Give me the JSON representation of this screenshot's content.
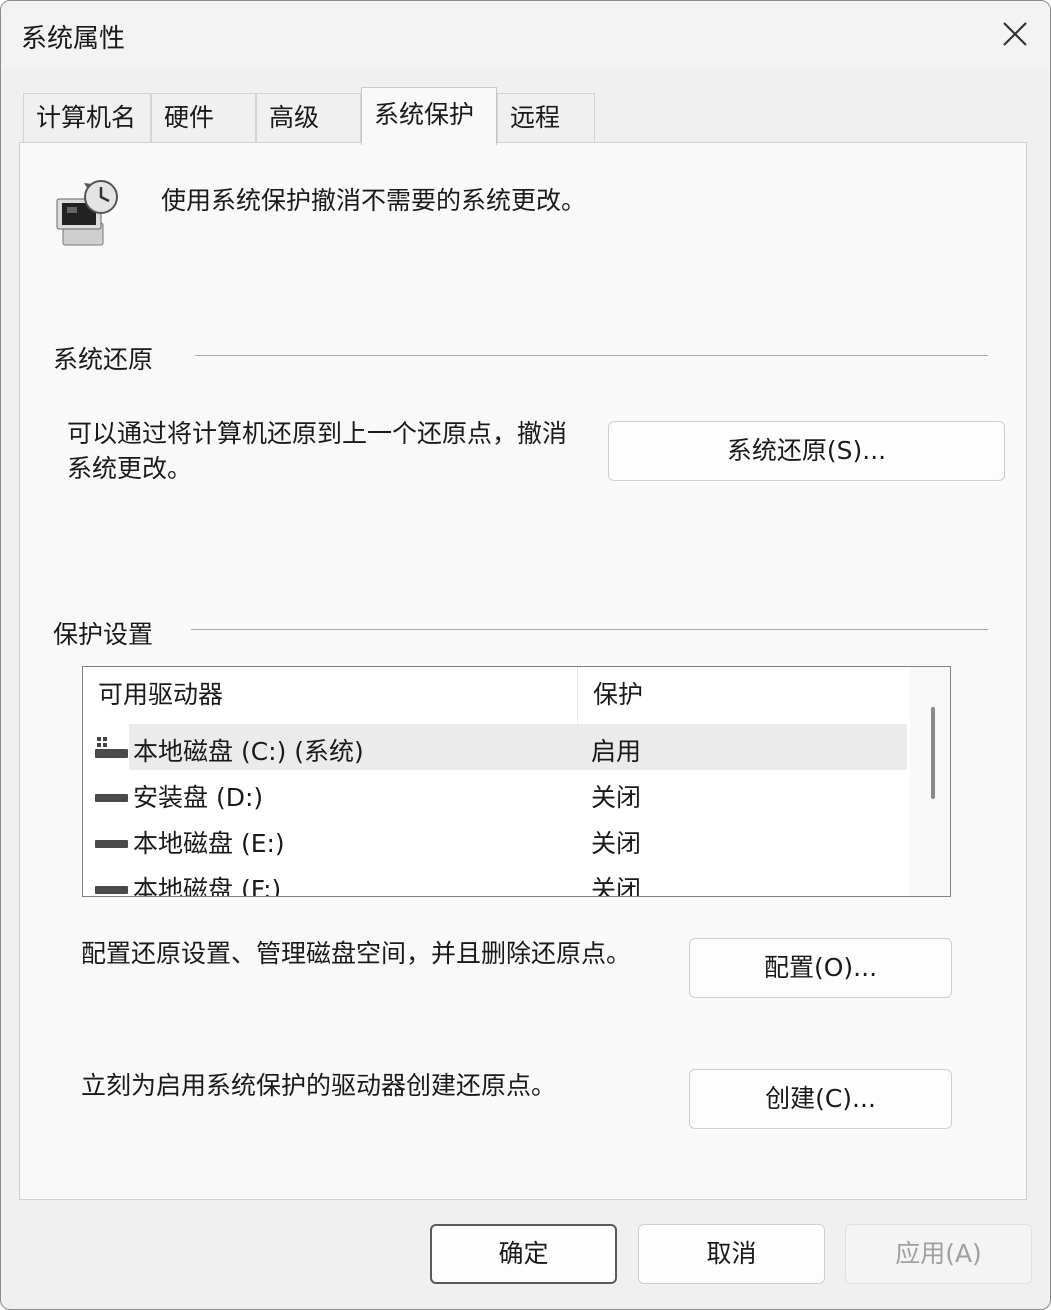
{
  "window": {
    "title": "系统属性"
  },
  "tabs": [
    {
      "label": "计算机名"
    },
    {
      "label": "硬件"
    },
    {
      "label": "高级"
    },
    {
      "label": "系统保护",
      "active": true
    },
    {
      "label": "远程"
    }
  ],
  "header": {
    "icon": "computer-restore-icon",
    "text": "使用系统保护撤消不需要的系统更改。"
  },
  "system_restore": {
    "title": "系统还原",
    "description_line1": "可以通过将计算机还原到上一个还原点，撤消",
    "description_line2": "系统更改。",
    "button_label": "系统还原(S)..."
  },
  "protection": {
    "title": "保护设置",
    "columns": [
      "可用驱动器",
      "保护"
    ],
    "drives": [
      {
        "name": "本地磁盘 (C:) (系统)",
        "status": "启用",
        "icon": "system-drive-icon",
        "selected": true
      },
      {
        "name": "安装盘 (D:)",
        "status": "关闭",
        "icon": "drive-icon"
      },
      {
        "name": "本地磁盘 (E:)",
        "status": "关闭",
        "icon": "drive-icon"
      },
      {
        "name": "本地磁盘 (F:)",
        "status": "关闭",
        "icon": "drive-icon"
      }
    ],
    "configure_text": "配置还原设置、管理磁盘空间，并且删除还原点。",
    "configure_button": "配置(O)...",
    "create_text": "立刻为启用系统保护的驱动器创建还原点。",
    "create_button": "创建(C)..."
  },
  "footer": {
    "ok": "确定",
    "cancel": "取消",
    "apply": "应用(A)"
  }
}
